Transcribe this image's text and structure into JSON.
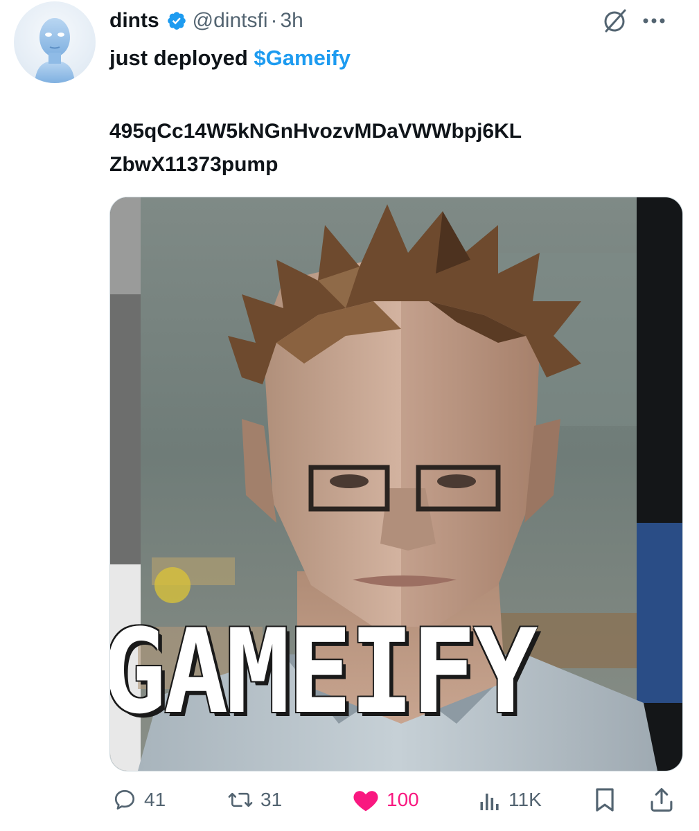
{
  "author": {
    "display_name": "dints",
    "handle": "@dintsfi",
    "separator": "·",
    "time": "3h"
  },
  "tweet": {
    "text_prefix": "just deployed ",
    "cashtag": "$Gameify",
    "contract_line1": "495qCc14W5kNGnHvozvMDaVWWbpj6KL",
    "contract_line2": "ZbwX11373pump"
  },
  "media": {
    "overlay_text": "GAMEIFY"
  },
  "actions": {
    "replies": "41",
    "reposts": "31",
    "likes": "100",
    "views": "11K"
  },
  "colors": {
    "accent": "#1d9bf0",
    "like": "#f91880",
    "muted": "#536471"
  }
}
